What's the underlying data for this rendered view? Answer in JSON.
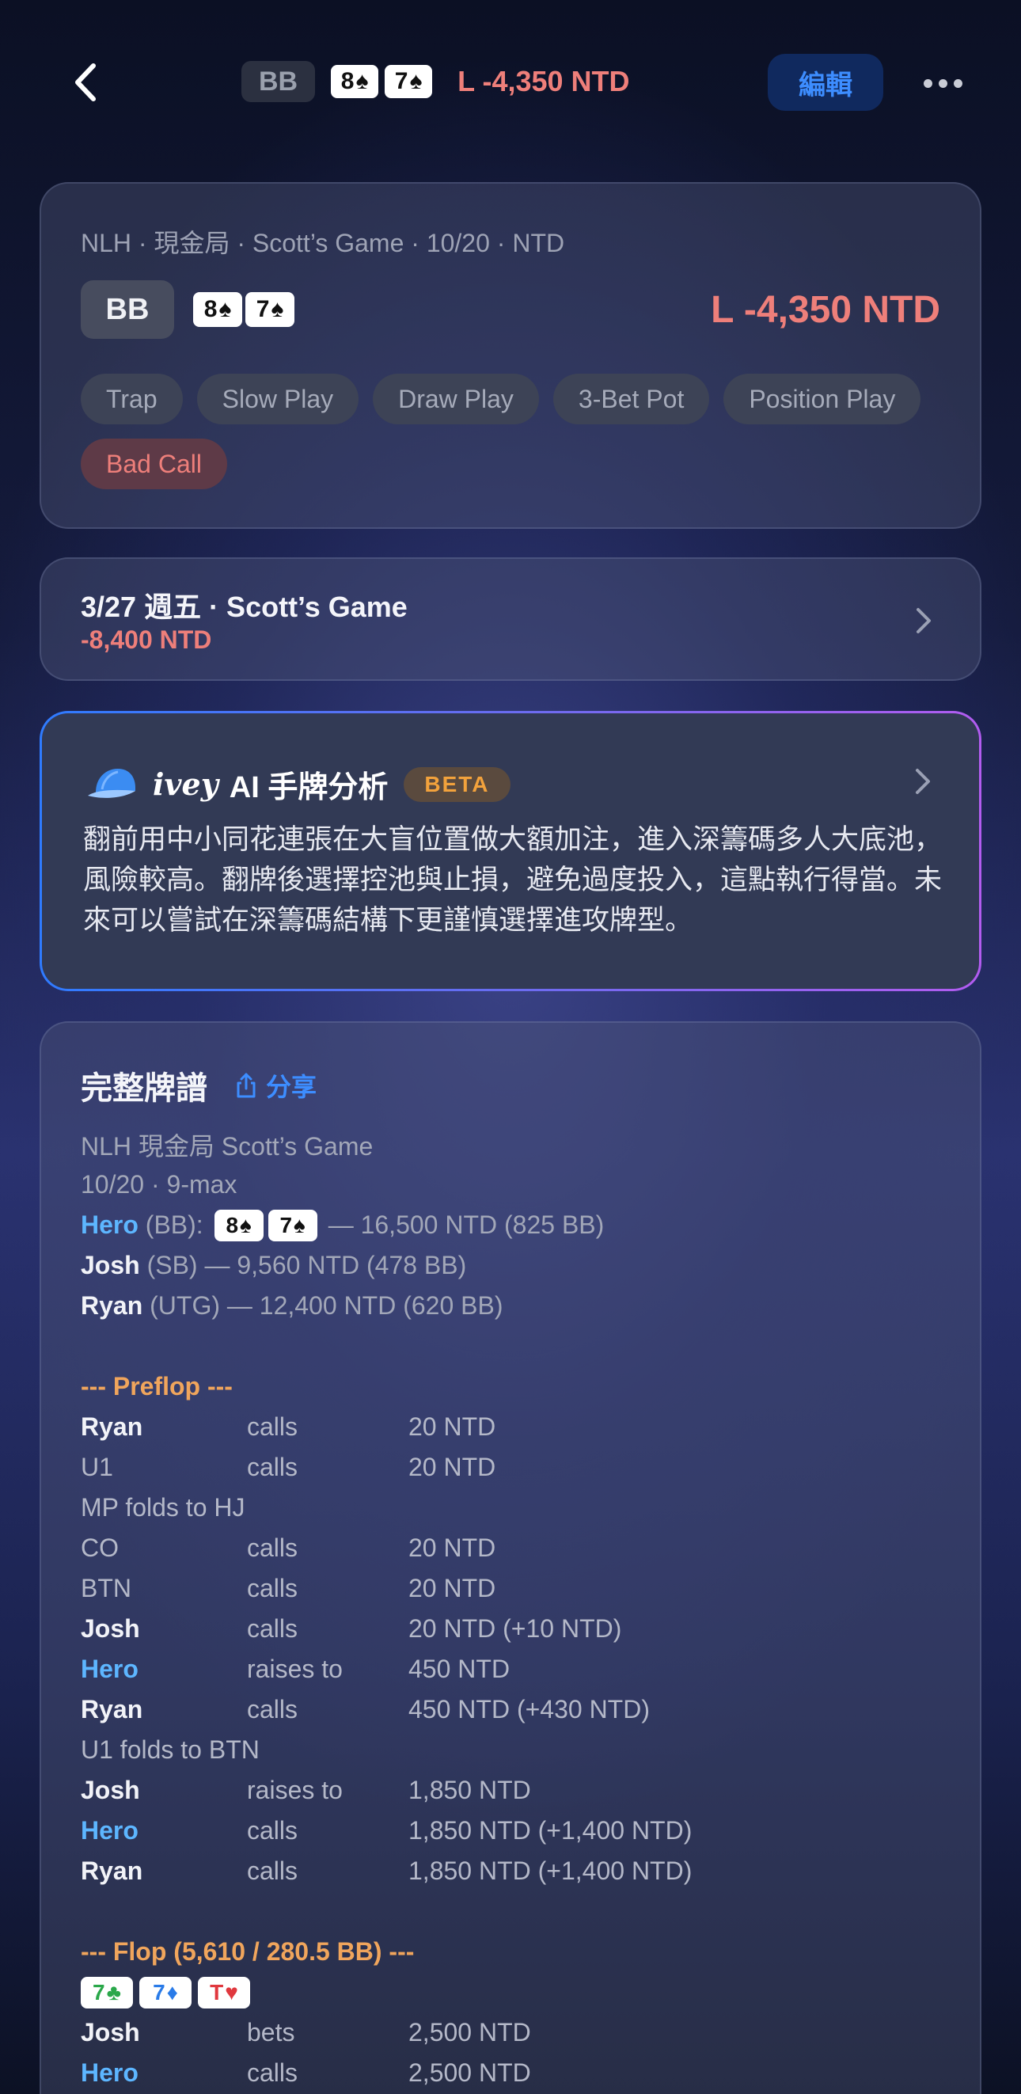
{
  "header": {
    "position": "BB",
    "cards": [
      {
        "rank": "8",
        "suit": "♠"
      },
      {
        "rank": "7",
        "suit": "♠"
      }
    ],
    "result": "L -4,350 NTD",
    "edit_label": "編輯"
  },
  "summary": {
    "meta": "NLH · 現金局 · Scott’s Game · 10/20 · NTD",
    "position": "BB",
    "cards": [
      {
        "rank": "8",
        "suit": "♠"
      },
      {
        "rank": "7",
        "suit": "♠"
      }
    ],
    "result": "L -4,350 NTD",
    "tags": [
      "Trap",
      "Slow Play",
      "Draw Play",
      "3-Bet Pot",
      "Position Play",
      "Bad Call"
    ]
  },
  "session": {
    "title": "3/27 週五 · Scott’s Game",
    "amount": "-8,400 NTD"
  },
  "ai": {
    "logo": "ivey",
    "title": "AI 手牌分析",
    "badge": "BETA",
    "text": "翻前用中小同花連張在大盲位置做大額加注，進入深籌碼多人大底池，風險較高。翻牌後選擇控池與止損，避免過度投入，這點執行得當。未來可以嘗試在深籌碼結構下更謹慎選擇進攻牌型。"
  },
  "record": {
    "title": "完整牌譜",
    "share_label": "分享",
    "game_line": "NLH 現金局 Scott’s Game",
    "date_line": "10/20 · 9-max",
    "players": [
      {
        "name": "Hero",
        "pos": "(BB):",
        "stack": "— 16,500 NTD (825 BB)"
      },
      {
        "name": "Josh",
        "pos": "(SB)",
        "stack": "— 9,560 NTD (478 BB)"
      },
      {
        "name": "Ryan",
        "pos": "(UTG)",
        "stack": "— 12,400 NTD (620 BB)"
      }
    ],
    "preflop_header": "--- Preflop ---",
    "preflop": [
      {
        "actor": "Ryan",
        "action": "calls",
        "amount": "20 NTD"
      },
      {
        "actor": "U1",
        "action": "calls",
        "amount": "20 NTD"
      },
      {
        "text": "MP folds to HJ"
      },
      {
        "actor": "CO",
        "action": "calls",
        "amount": "20 NTD"
      },
      {
        "actor": "BTN",
        "action": "calls",
        "amount": "20 NTD"
      },
      {
        "actor": "Josh",
        "action": "calls",
        "amount": "20 NTD (+10 NTD)"
      },
      {
        "actor": "Hero",
        "action": "raises to",
        "amount": "450 NTD"
      },
      {
        "actor": "Ryan",
        "action": "calls",
        "amount": "450 NTD (+430 NTD)"
      },
      {
        "text": "U1 folds to BTN"
      },
      {
        "actor": "Josh",
        "action": "raises to",
        "amount": "1,850 NTD"
      },
      {
        "actor": "Hero",
        "action": "calls",
        "amount": "1,850 NTD (+1,400 NTD)"
      },
      {
        "actor": "Ryan",
        "action": "calls",
        "amount": "1,850 NTD (+1,400 NTD)"
      }
    ],
    "flop_header": "--- Flop (5,610 / 280.5 BB) ---",
    "flop_cards": [
      {
        "rank": "7",
        "suit": "♣",
        "color": "#2aa84a"
      },
      {
        "rank": "7",
        "suit": "♦",
        "color": "#2a7be8"
      },
      {
        "rank": "T",
        "suit": "♥",
        "color": "#e0383e"
      }
    ],
    "flop": [
      {
        "actor": "Josh",
        "action": "bets",
        "amount": "2,500 NTD"
      },
      {
        "actor": "Hero",
        "action": "calls",
        "amount": "2,500 NTD"
      }
    ]
  }
}
